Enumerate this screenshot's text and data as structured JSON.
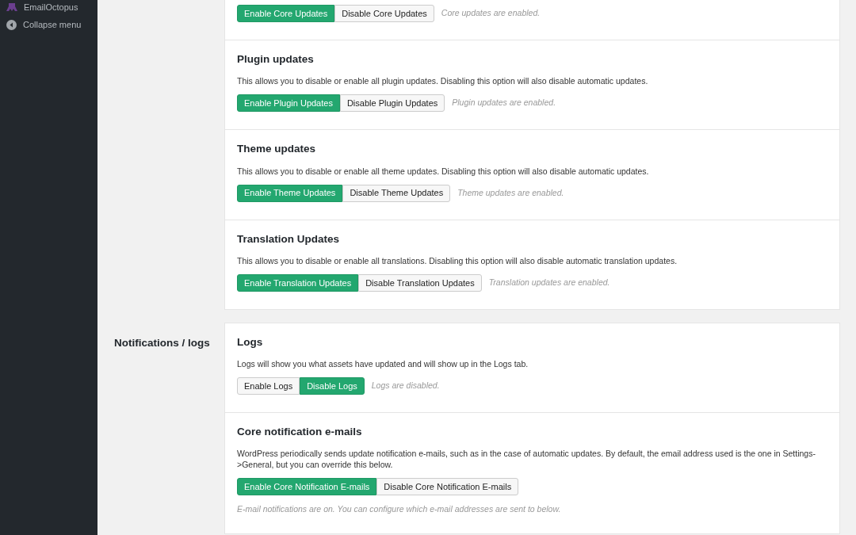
{
  "sidebar": {
    "items": [
      {
        "kind": "plugin",
        "label": "EmailOctopus"
      },
      {
        "kind": "collapse",
        "label": "Collapse menu"
      }
    ]
  },
  "groups": [
    {
      "sections": [
        {
          "kind": "inline",
          "buttons": [
            {
              "label": "Enable Core Updates",
              "selected": true
            },
            {
              "label": "Disable Core Updates",
              "selected": false
            }
          ],
          "status": "Core updates are enabled."
        },
        {
          "kind": "inline",
          "title": "Plugin updates",
          "description": "This allows you to disable or enable all plugin updates. Disabling this option will also disable automatic updates.",
          "buttons": [
            {
              "label": "Enable Plugin Updates",
              "selected": true
            },
            {
              "label": "Disable Plugin Updates",
              "selected": false
            }
          ],
          "status": "Plugin updates are enabled."
        },
        {
          "kind": "inline",
          "title": "Theme updates",
          "description": "This allows you to disable or enable all theme updates. Disabling this option will also disable automatic updates.",
          "buttons": [
            {
              "label": "Enable Theme Updates",
              "selected": true
            },
            {
              "label": "Disable Theme Updates",
              "selected": false
            }
          ],
          "status": "Theme updates are enabled."
        },
        {
          "kind": "inline",
          "title": "Translation Updates",
          "description": "This allows you to disable or enable all translations. Disabling this option will also disable automatic translation updates.",
          "buttons": [
            {
              "label": "Enable Translation Updates",
              "selected": true
            },
            {
              "label": "Disable Translation Updates",
              "selected": false
            }
          ],
          "status": "Translation updates are enabled."
        }
      ]
    },
    {
      "label": "Notifications / logs",
      "sections": [
        {
          "kind": "inline",
          "title": "Logs",
          "description": "Logs will show you what assets have updated and will show up in the Logs tab.",
          "buttons": [
            {
              "label": "Enable Logs",
              "selected": false
            },
            {
              "label": "Disable Logs",
              "selected": true
            }
          ],
          "status": "Logs are disabled."
        },
        {
          "kind": "below",
          "title": "Core notification e-mails",
          "description": "WordPress periodically sends update notification e-mails, such as in the case of automatic updates. By default, the email address used is the one in Settings->General, but you can override this below.",
          "buttons": [
            {
              "label": "Enable Core Notification E-mails",
              "selected": true
            },
            {
              "label": "Disable Core Notification E-mails",
              "selected": false
            }
          ],
          "status": "E-mail notifications are on. You can configure which e-mail addresses are sent to below."
        }
      ]
    }
  ]
}
